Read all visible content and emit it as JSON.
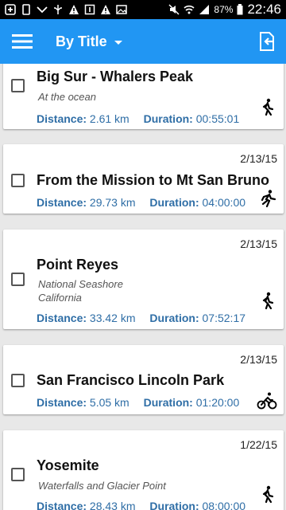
{
  "status_bar": {
    "icons": [
      "plus-box-icon",
      "phone-outline-icon",
      "missed-call-icon",
      "usb-icon",
      "warning-icon",
      "calendar-icon",
      "warning-icon",
      "image-icon",
      "mute-icon",
      "wifi-icon",
      "signal-icon"
    ],
    "battery": "87%",
    "time": "22:46"
  },
  "app_bar": {
    "title": "By Title",
    "color": "#2196f3"
  },
  "labels": {
    "distance": "Distance:",
    "duration": "Duration:"
  },
  "routes": [
    {
      "date": "",
      "title": "Big Sur - Whalers Peak",
      "description": [
        "At the ocean"
      ],
      "distance": "2.61 km",
      "duration": "00:55:01",
      "activity": "walking"
    },
    {
      "date": "2/13/15",
      "title": "From the Mission to Mt San Bruno",
      "description": [],
      "distance": "29.73 km",
      "duration": "04:00:00",
      "activity": "running"
    },
    {
      "date": "2/13/15",
      "title": "Point Reyes",
      "description": [
        "National Seashore",
        "California"
      ],
      "distance": "33.42 km",
      "duration": "07:52:17",
      "activity": "walking"
    },
    {
      "date": "2/13/15",
      "title": "San Francisco Lincoln Park",
      "description": [],
      "distance": "5.05 km",
      "duration": "01:20:00",
      "activity": "cycling"
    },
    {
      "date": "1/22/15",
      "title": "Yosemite",
      "description": [
        "Waterfalls and Glacier Point"
      ],
      "distance": "28.43 km",
      "duration": "08:00:00",
      "activity": "walking"
    }
  ]
}
